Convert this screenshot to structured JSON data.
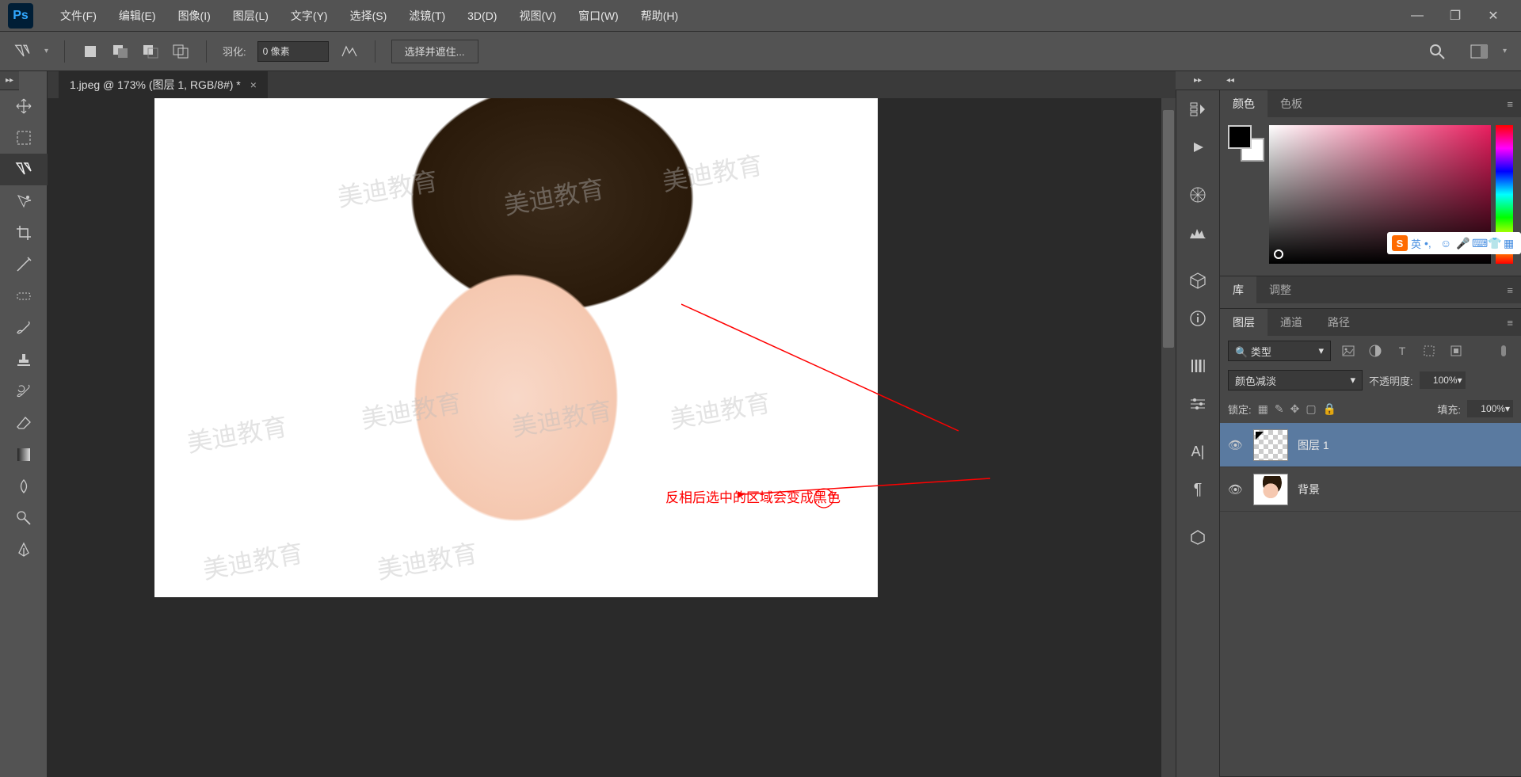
{
  "app": {
    "logo": "Ps"
  },
  "menu": {
    "file": "文件(F)",
    "edit": "编辑(E)",
    "image": "图像(I)",
    "layer": "图层(L)",
    "type": "文字(Y)",
    "select": "选择(S)",
    "filter": "滤镜(T)",
    "threed": "3D(D)",
    "view": "视图(V)",
    "window": "窗口(W)",
    "help": "帮助(H)"
  },
  "options": {
    "feather_label": "羽化:",
    "feather_value": "0 像素",
    "select_mask": "选择并遮住..."
  },
  "document": {
    "tab_title": "1.jpeg @ 173% (图层 1, RGB/8#) *"
  },
  "annotation": {
    "text": "反相后选中的区域会变成黑色",
    "watermark": "美迪教育"
  },
  "panels": {
    "color": {
      "tab_color": "颜色",
      "tab_swatches": "色板"
    },
    "library": {
      "tab_lib": "库",
      "tab_adjust": "调整"
    },
    "layers": {
      "tab_layers": "图层",
      "tab_channels": "通道",
      "tab_paths": "路径",
      "filter_label": "类型",
      "blend_mode": "颜色减淡",
      "opacity_label": "不透明度:",
      "opacity_value": "100%",
      "lock_label": "锁定:",
      "fill_label": "填充:",
      "fill_value": "100%",
      "items": [
        {
          "name": "图层 1"
        },
        {
          "name": "背景"
        }
      ]
    }
  },
  "ime": {
    "lang": "英"
  }
}
